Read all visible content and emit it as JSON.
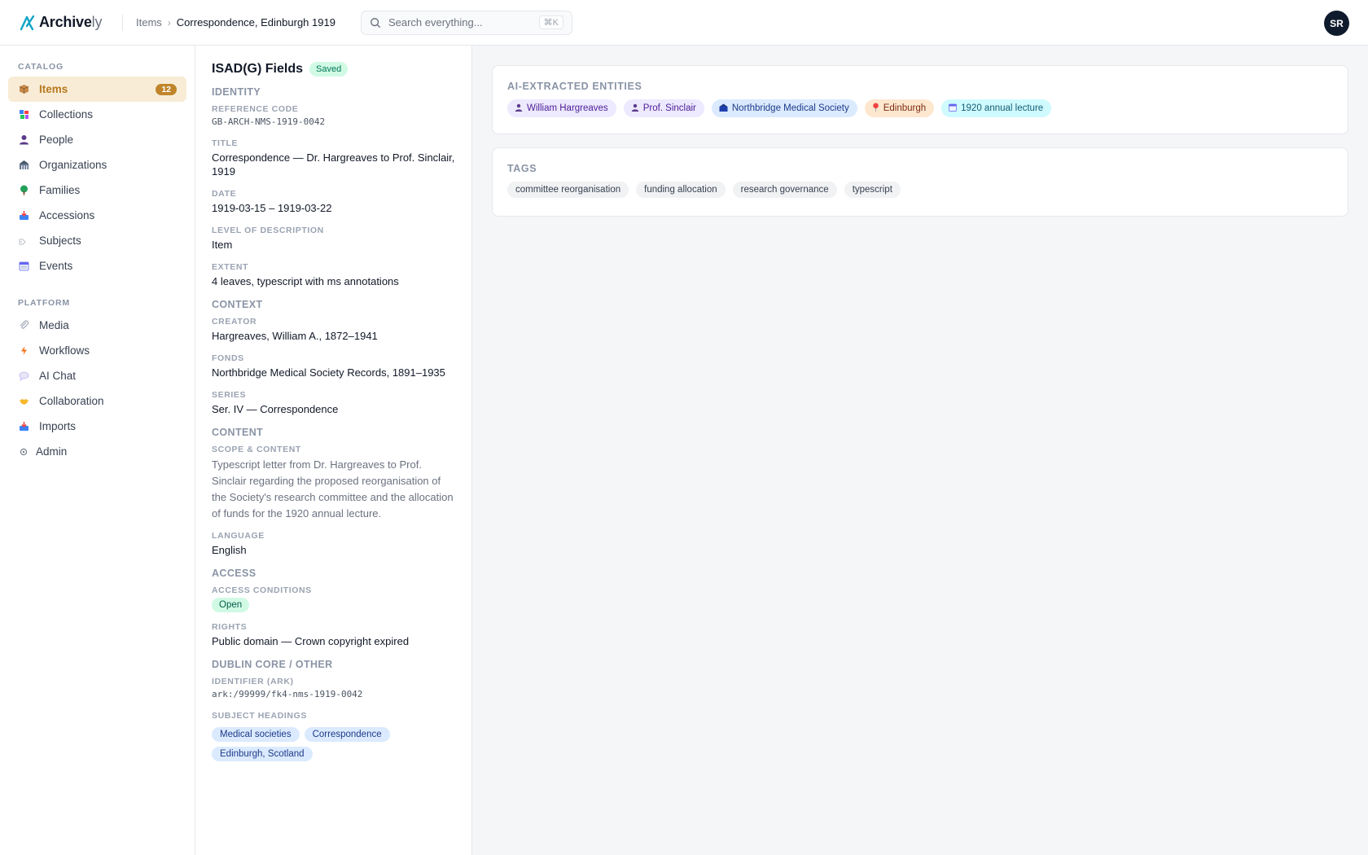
{
  "app": {
    "name": "Archive",
    "name_suffix": "ly"
  },
  "breadcrumb": {
    "parent": "Items",
    "current": "Correspondence, Edinburgh 1919"
  },
  "search": {
    "placeholder": "Search everything...",
    "shortcut": "⌘K"
  },
  "user": {
    "initials": "SR"
  },
  "sidebar": {
    "catalog_label": "CATALOG",
    "catalog_items": [
      {
        "label": "Items",
        "icon": "box-icon",
        "badge": "12",
        "active": true
      },
      {
        "label": "Collections",
        "icon": "collections-icon"
      },
      {
        "label": "People",
        "icon": "person-icon"
      },
      {
        "label": "Organizations",
        "icon": "building-icon"
      },
      {
        "label": "Families",
        "icon": "tree-icon"
      },
      {
        "label": "Accessions",
        "icon": "inbox-icon"
      },
      {
        "label": "Subjects",
        "icon": "tag-icon"
      },
      {
        "label": "Events",
        "icon": "calendar-icon"
      }
    ],
    "platform_label": "PLATFORM",
    "platform_items": [
      {
        "label": "Media",
        "icon": "paperclip-icon"
      },
      {
        "label": "Workflows",
        "icon": "lightning-icon"
      },
      {
        "label": "AI Chat",
        "icon": "chat-bubble-icon"
      },
      {
        "label": "Collaboration",
        "icon": "handshake-icon"
      },
      {
        "label": "Imports",
        "icon": "import-tray-icon"
      },
      {
        "label": "Admin",
        "icon": "gear-icon"
      }
    ]
  },
  "fields": {
    "title": "ISAD(G) Fields",
    "status": "Saved",
    "identity": {
      "heading": "IDENTITY",
      "reference_code_label": "REFERENCE CODE",
      "reference_code": "GB-ARCH-NMS-1919-0042",
      "title_label": "TITLE",
      "title": "Correspondence — Dr. Hargreaves to Prof. Sinclair, 1919",
      "date_label": "DATE",
      "date": "1919-03-15 – 1919-03-22",
      "level_label": "LEVEL OF DESCRIPTION",
      "level": "Item",
      "extent_label": "EXTENT",
      "extent": "4 leaves, typescript with ms annotations"
    },
    "context": {
      "heading": "CONTEXT",
      "creator_label": "CREATOR",
      "creator": "Hargreaves, William A., 1872–1941",
      "fonds_label": "FONDS",
      "fonds": "Northbridge Medical Society Records, 1891–1935",
      "series_label": "SERIES",
      "series": "Ser. IV — Correspondence"
    },
    "content": {
      "heading": "CONTENT",
      "scope_label": "SCOPE & CONTENT",
      "scope": "Typescript letter from Dr. Hargreaves to Prof. Sinclair regarding the proposed reorganisation of the Society's research committee and the allocation of funds for the 1920 annual lecture.",
      "language_label": "LANGUAGE",
      "language": "English"
    },
    "access": {
      "heading": "ACCESS",
      "conditions_label": "ACCESS CONDITIONS",
      "conditions": "Open",
      "rights_label": "RIGHTS",
      "rights": "Public domain — Crown copyright expired"
    },
    "dublin_core": {
      "heading": "DUBLIN CORE / OTHER",
      "identifier_label": "IDENTIFIER (ARK)",
      "identifier": "ark:/99999/fk4-nms-1919-0042",
      "subjects_label": "SUBJECT HEADINGS",
      "subjects": [
        "Medical societies",
        "Correspondence",
        "Edinburgh, Scotland"
      ]
    }
  },
  "entities": {
    "heading": "AI-EXTRACTED ENTITIES",
    "items": [
      {
        "label": "William Hargreaves",
        "type": "person",
        "icon": "person-icon"
      },
      {
        "label": "Prof. Sinclair",
        "type": "person",
        "icon": "person-icon"
      },
      {
        "label": "Northbridge Medical Society",
        "type": "organization",
        "icon": "building-icon"
      },
      {
        "label": "Edinburgh",
        "type": "place",
        "icon": "pin-icon"
      },
      {
        "label": "1920 annual lecture",
        "type": "event",
        "icon": "calendar-icon"
      }
    ]
  },
  "tags": {
    "heading": "TAGS",
    "items": [
      "committee reorganisation",
      "funding allocation",
      "research governance",
      "typescript"
    ]
  },
  "colors": {
    "accent": "#c0852a",
    "active_bg": "#f8ecd6",
    "logo_teal": "#0ea5c6",
    "person_chip": "#ede9fe",
    "org_chip": "#dbeafe",
    "place_chip": "#fde7cf",
    "event_chip": "#cffafe"
  }
}
